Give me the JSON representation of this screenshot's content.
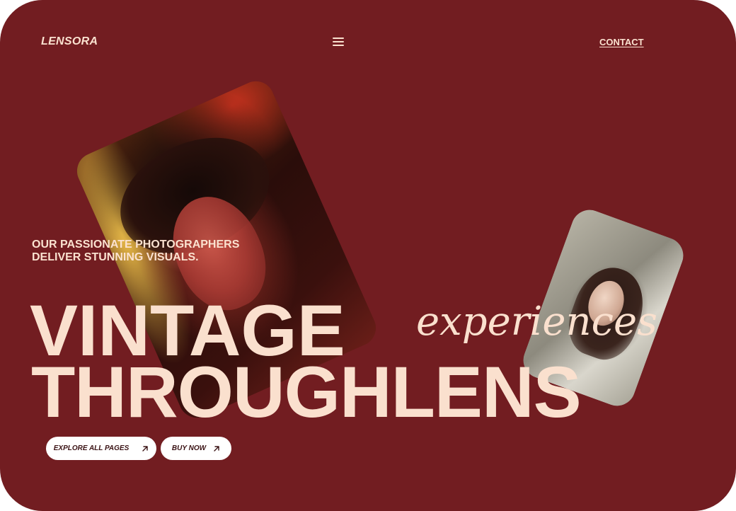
{
  "header": {
    "logo": "LENSORA",
    "menu_icon": "hamburger-menu-icon",
    "contact_label": "CONTACT"
  },
  "hero": {
    "subtitle_line1": "OUR PASSIONATE PHOTOGRAPHERS",
    "subtitle_line2": "DELIVER STUNNING VISUALS.",
    "headline_line1": "VINTAGE",
    "headline_script": "experiences",
    "headline_line2": "THROUGHLENS"
  },
  "buttons": {
    "explore_label": "EXPLORE ALL PAGES",
    "buy_label": "BUY NOW",
    "icon": "arrow-up-right-icon"
  },
  "colors": {
    "background": "#721d21",
    "text": "#fae0ce",
    "button_bg": "#ffffff",
    "button_text": "#3a1214"
  }
}
